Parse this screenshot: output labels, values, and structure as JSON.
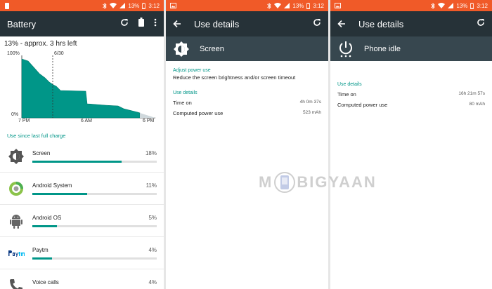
{
  "status": {
    "battery_pct": "13%",
    "time": "3:12"
  },
  "panel1": {
    "title": "Battery",
    "estimate": "13% - approx. 3 hrs left",
    "chart": {
      "y_top": "100%",
      "y_bottom": "0%",
      "marker": "6/30",
      "x_labels": [
        "7 PM",
        "6 AM",
        "6 PM"
      ]
    },
    "section_label": "Use since last full charge",
    "items": [
      {
        "label": "Screen",
        "pct": "18%",
        "fraction": 0.72,
        "icon": "brightness-icon"
      },
      {
        "label": "Android System",
        "pct": "11%",
        "fraction": 0.44,
        "icon": "android-system-icon"
      },
      {
        "label": "Android OS",
        "pct": "5%",
        "fraction": 0.2,
        "icon": "android-icon"
      },
      {
        "label": "Paytm",
        "pct": "4%",
        "fraction": 0.16,
        "icon": "paytm-icon"
      },
      {
        "label": "Voice calls",
        "pct": "4%",
        "fraction": 0.16,
        "icon": "phone-icon"
      }
    ]
  },
  "panel2": {
    "title": "Use details",
    "sub_title": "Screen",
    "adjust_head": "Adjust power use",
    "adjust_text": "Reduce the screen brightness and/or screen timeout",
    "details_head": "Use details",
    "time_on_label": "Time on",
    "time_on_value": "4h 0m 37s",
    "power_label": "Computed power use",
    "power_value": "523 mAh"
  },
  "panel3": {
    "title": "Use details",
    "sub_title": "Phone idle",
    "details_head": "Use details",
    "time_on_label": "Time on",
    "time_on_value": "16h 21m 57s",
    "power_label": "Computed power use",
    "power_value": "80 mAh"
  },
  "watermark": {
    "left": "M",
    "right": "BIGYAAN"
  },
  "colors": {
    "status_bar": "#f05a28",
    "app_bar": "#263238",
    "sub_header": "#37474f",
    "accent": "#009688"
  }
}
